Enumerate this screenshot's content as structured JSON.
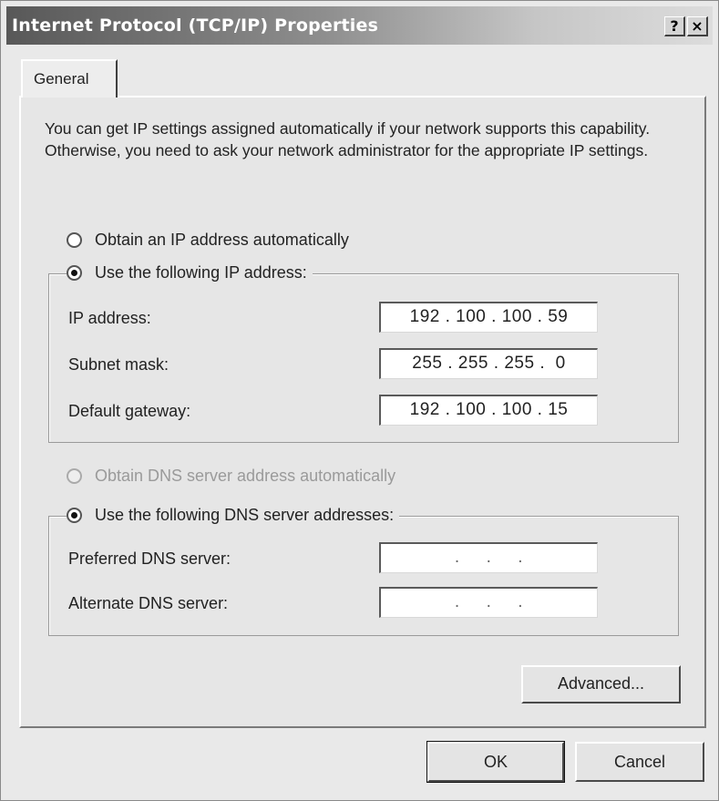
{
  "window": {
    "title": "Internet Protocol (TCP/IP) Properties",
    "help_label": "?",
    "close_label": "×"
  },
  "tabs": [
    {
      "label": "General",
      "selected": true
    }
  ],
  "intro_text": "You can get IP settings assigned automatically if your network supports this capability. Otherwise, you need to ask your network administrator for the appropriate IP settings.",
  "ip_section": {
    "auto_option": {
      "label": "Obtain an IP address automatically",
      "selected": false
    },
    "manual_option": {
      "label": "Use the following IP address:",
      "selected": true
    },
    "fields": [
      {
        "label": "IP address:",
        "value": "192 . 100 . 100 . 59"
      },
      {
        "label": "Subnet mask:",
        "value": "255 . 255 . 255 .  0"
      },
      {
        "label": "Default gateway:",
        "value": "192 . 100 . 100 . 15"
      }
    ]
  },
  "dns_section": {
    "auto_option": {
      "label": "Obtain DNS server address automatically",
      "selected": false,
      "disabled": true
    },
    "manual_option": {
      "label": "Use the following DNS server addresses:",
      "selected": true
    },
    "fields": [
      {
        "label": "Preferred DNS server:",
        "value": " .     .     . "
      },
      {
        "label": "Alternate DNS server:",
        "value": " .     .     . "
      }
    ]
  },
  "buttons": {
    "advanced": "Advanced...",
    "ok": "OK",
    "cancel": "Cancel"
  }
}
